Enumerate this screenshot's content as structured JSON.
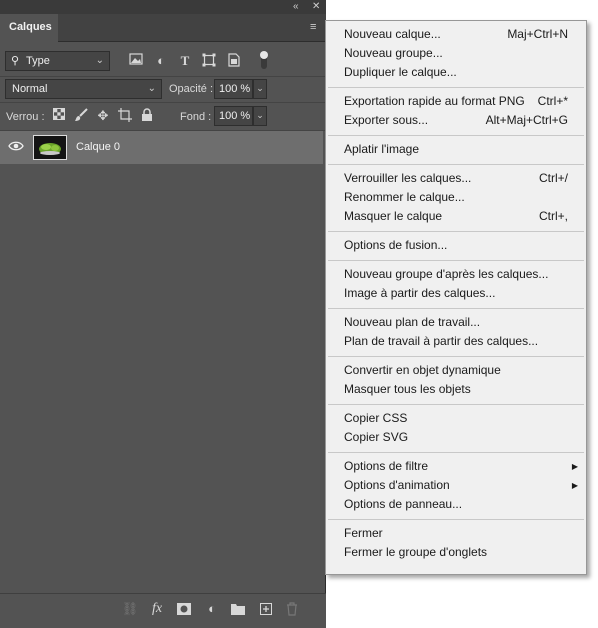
{
  "panel": {
    "tab_label": "Calques",
    "collapse_icon": "double-chevron-left",
    "close_icon": "close-x",
    "menu_icon": "hamburger",
    "filter": {
      "kind": "Type",
      "icons": [
        "image-filter-icon",
        "adjustment-filter-icon",
        "text-filter-icon",
        "shape-filter-icon",
        "smart-object-filter-icon"
      ]
    },
    "blend_mode": "Normal",
    "opacity_label": "Opacité :",
    "opacity_value": "100 %",
    "lock_label": "Verrou :",
    "fill_label": "Fond :",
    "fill_value": "100 %",
    "layers": [
      {
        "name": "Calque 0",
        "visible": true
      }
    ],
    "bottom_icons": [
      "link-icon",
      "fx-icon",
      "mask-icon",
      "adjustment-icon",
      "folder-icon",
      "new-layer-icon",
      "trash-icon"
    ]
  },
  "menu": {
    "groups": [
      [
        {
          "label": "Nouveau calque...",
          "shortcut": "Maj+Ctrl+N"
        },
        {
          "label": "Nouveau groupe...",
          "shortcut": ""
        },
        {
          "label": "Dupliquer le calque...",
          "shortcut": ""
        }
      ],
      [
        {
          "label": "Exportation rapide au format PNG",
          "shortcut": "Ctrl+*"
        },
        {
          "label": "Exporter sous...",
          "shortcut": "Alt+Maj+Ctrl+G"
        }
      ],
      [
        {
          "label": "Aplatir l'image",
          "shortcut": ""
        }
      ],
      [
        {
          "label": "Verrouiller les calques...",
          "shortcut": "Ctrl+/"
        },
        {
          "label": "Renommer le calque...",
          "shortcut": ""
        },
        {
          "label": "Masquer le calque",
          "shortcut": "Ctrl+,"
        }
      ],
      [
        {
          "label": "Options de fusion...",
          "shortcut": ""
        }
      ],
      [
        {
          "label": "Nouveau groupe d'après les calques...",
          "shortcut": ""
        },
        {
          "label": "Image à partir des calques...",
          "shortcut": ""
        }
      ],
      [
        {
          "label": "Nouveau plan de travail...",
          "shortcut": ""
        },
        {
          "label": "Plan de travail à partir des calques...",
          "shortcut": ""
        }
      ],
      [
        {
          "label": "Convertir en objet dynamique",
          "shortcut": ""
        },
        {
          "label": "Masquer tous les objets",
          "shortcut": ""
        }
      ],
      [
        {
          "label": "Copier CSS",
          "shortcut": ""
        },
        {
          "label": "Copier SVG",
          "shortcut": ""
        }
      ],
      [
        {
          "label": "Options de filtre",
          "shortcut": "",
          "submenu": true
        },
        {
          "label": "Options d'animation",
          "shortcut": "",
          "submenu": true
        },
        {
          "label": "Options de panneau...",
          "shortcut": ""
        }
      ],
      [
        {
          "label": "Fermer",
          "shortcut": ""
        },
        {
          "label": "Fermer le groupe d'onglets",
          "shortcut": ""
        }
      ]
    ]
  },
  "colors": {
    "panel_bg": "#535353",
    "selected_layer": "#6e6e6e",
    "menu_bg": "#f0f0f0"
  }
}
